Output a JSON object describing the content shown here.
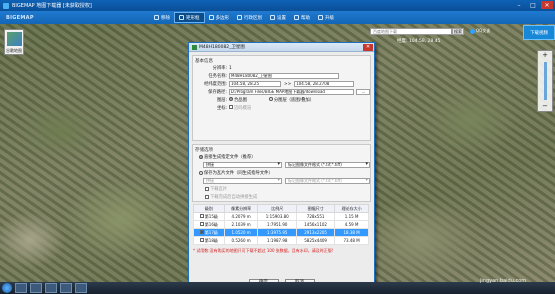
{
  "window": {
    "title": "BIGEMAP 地图下载器 [未获取授权]",
    "brand": "BIGEMAP",
    "close": "✕",
    "minimize": "–",
    "maximize": "□"
  },
  "toolbar": {
    "buttons": [
      "移除",
      "矩形框",
      "多边形",
      "行政区划",
      "设置",
      "帮助",
      "升级"
    ],
    "active_index": 1
  },
  "map_type": {
    "label": "谷歌地图"
  },
  "right_panel": {
    "search_placeholder": "百度地图下载",
    "search_button": "搜索",
    "qq_label": "QQ交谈",
    "helper_button": "下载视频",
    "coord_lon": "经度: 104.58,  28.45",
    "coord_lat": "纬度: 104.58,  28.45",
    "zoom_in": "+",
    "zoom_out": "−"
  },
  "dialog": {
    "title": "M48H180082_卫星图",
    "basic_section": "基本信息",
    "basic": {
      "id_label": "分辨率:",
      "id_value": "1",
      "name_label": "任务名称:",
      "name_value": "M48H180082_卫星图",
      "range_label": "经纬度范围:",
      "range_from": "104.58,  28.25",
      "range_sep": ">>",
      "range_to": "104.58,  28.2708",
      "path_label": "保存路径:",
      "path_value": "D:/Program Files/BIGE MAP地图下载器/download",
      "path_button": "...",
      "layer_label": "图层:",
      "layer_option1": "合品图",
      "layer_option2": "分图层（底图/叠加）",
      "coord_label": "坐标:",
      "coord_option": "迈码模渲"
    },
    "store_section": "存储选项",
    "store": {
      "opt_single": "直接生成指定文件（推荐）",
      "format_select": "拼接",
      "format_label": "标记图像文件格式 (*.tif;*.tiff)",
      "opt_tiles": "保存为瓦片文件（同生成指导文件）",
      "tile_select": "拼接",
      "tile_format": "标记图像文件格式 (*.tif;*.tiff)",
      "sub_opt1": "下载瓦片",
      "sub_opt2": "下载完成后自动拼接生成"
    },
    "table": {
      "headers": [
        "级别",
        "像素分辨率",
        "比例尺",
        "图幅尺寸",
        "理论存大小"
      ],
      "rows": [
        [
          "第15级",
          "4.2079   m",
          "1:15903.80",
          "728x551",
          "1.15 M"
        ],
        [
          "第16级",
          "2.1039   m",
          "1:7951.90",
          "1456x1102",
          "4.59 M"
        ],
        [
          "第17级",
          "1.0520   m",
          "1:3975.95",
          "2913x2205",
          "18.38 M"
        ],
        [
          "第18级",
          "0.5260   m",
          "1:1987.98",
          "5825x4409",
          "73.48 M"
        ]
      ],
      "selected_index": 2,
      "selected_checked": true
    },
    "warning": "* 试用数:没有购买的地图只可下载不超过 100 张数据，且有水印，请及时正版!",
    "ok_button": "确定",
    "cancel_button": "取消"
  },
  "taskbar": {
    "tray_time": ""
  },
  "watermark": "jingyan.baidu.com"
}
